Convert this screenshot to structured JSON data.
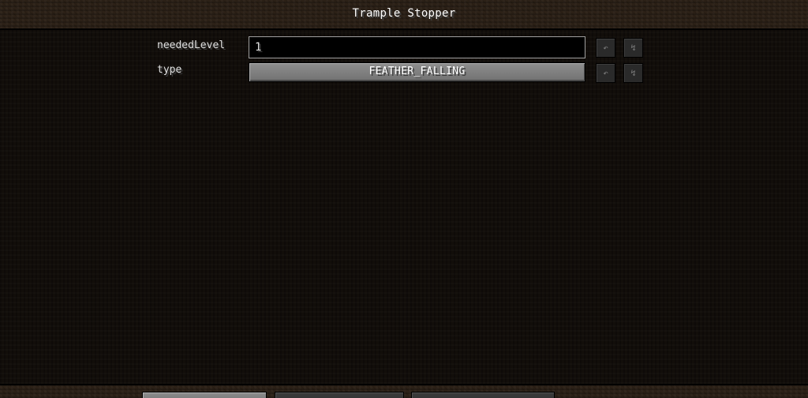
{
  "screen": {
    "title": "Trample Stopper"
  },
  "config": {
    "entries": [
      {
        "label": "neededLevel",
        "value": "1"
      },
      {
        "label": "type",
        "value": "FEATHER_FALLING"
      }
    ],
    "undo_icon": "↶",
    "reset_icon": "↯"
  },
  "icons": {
    "undo": "undo-icon",
    "reset": "reset-icon"
  }
}
